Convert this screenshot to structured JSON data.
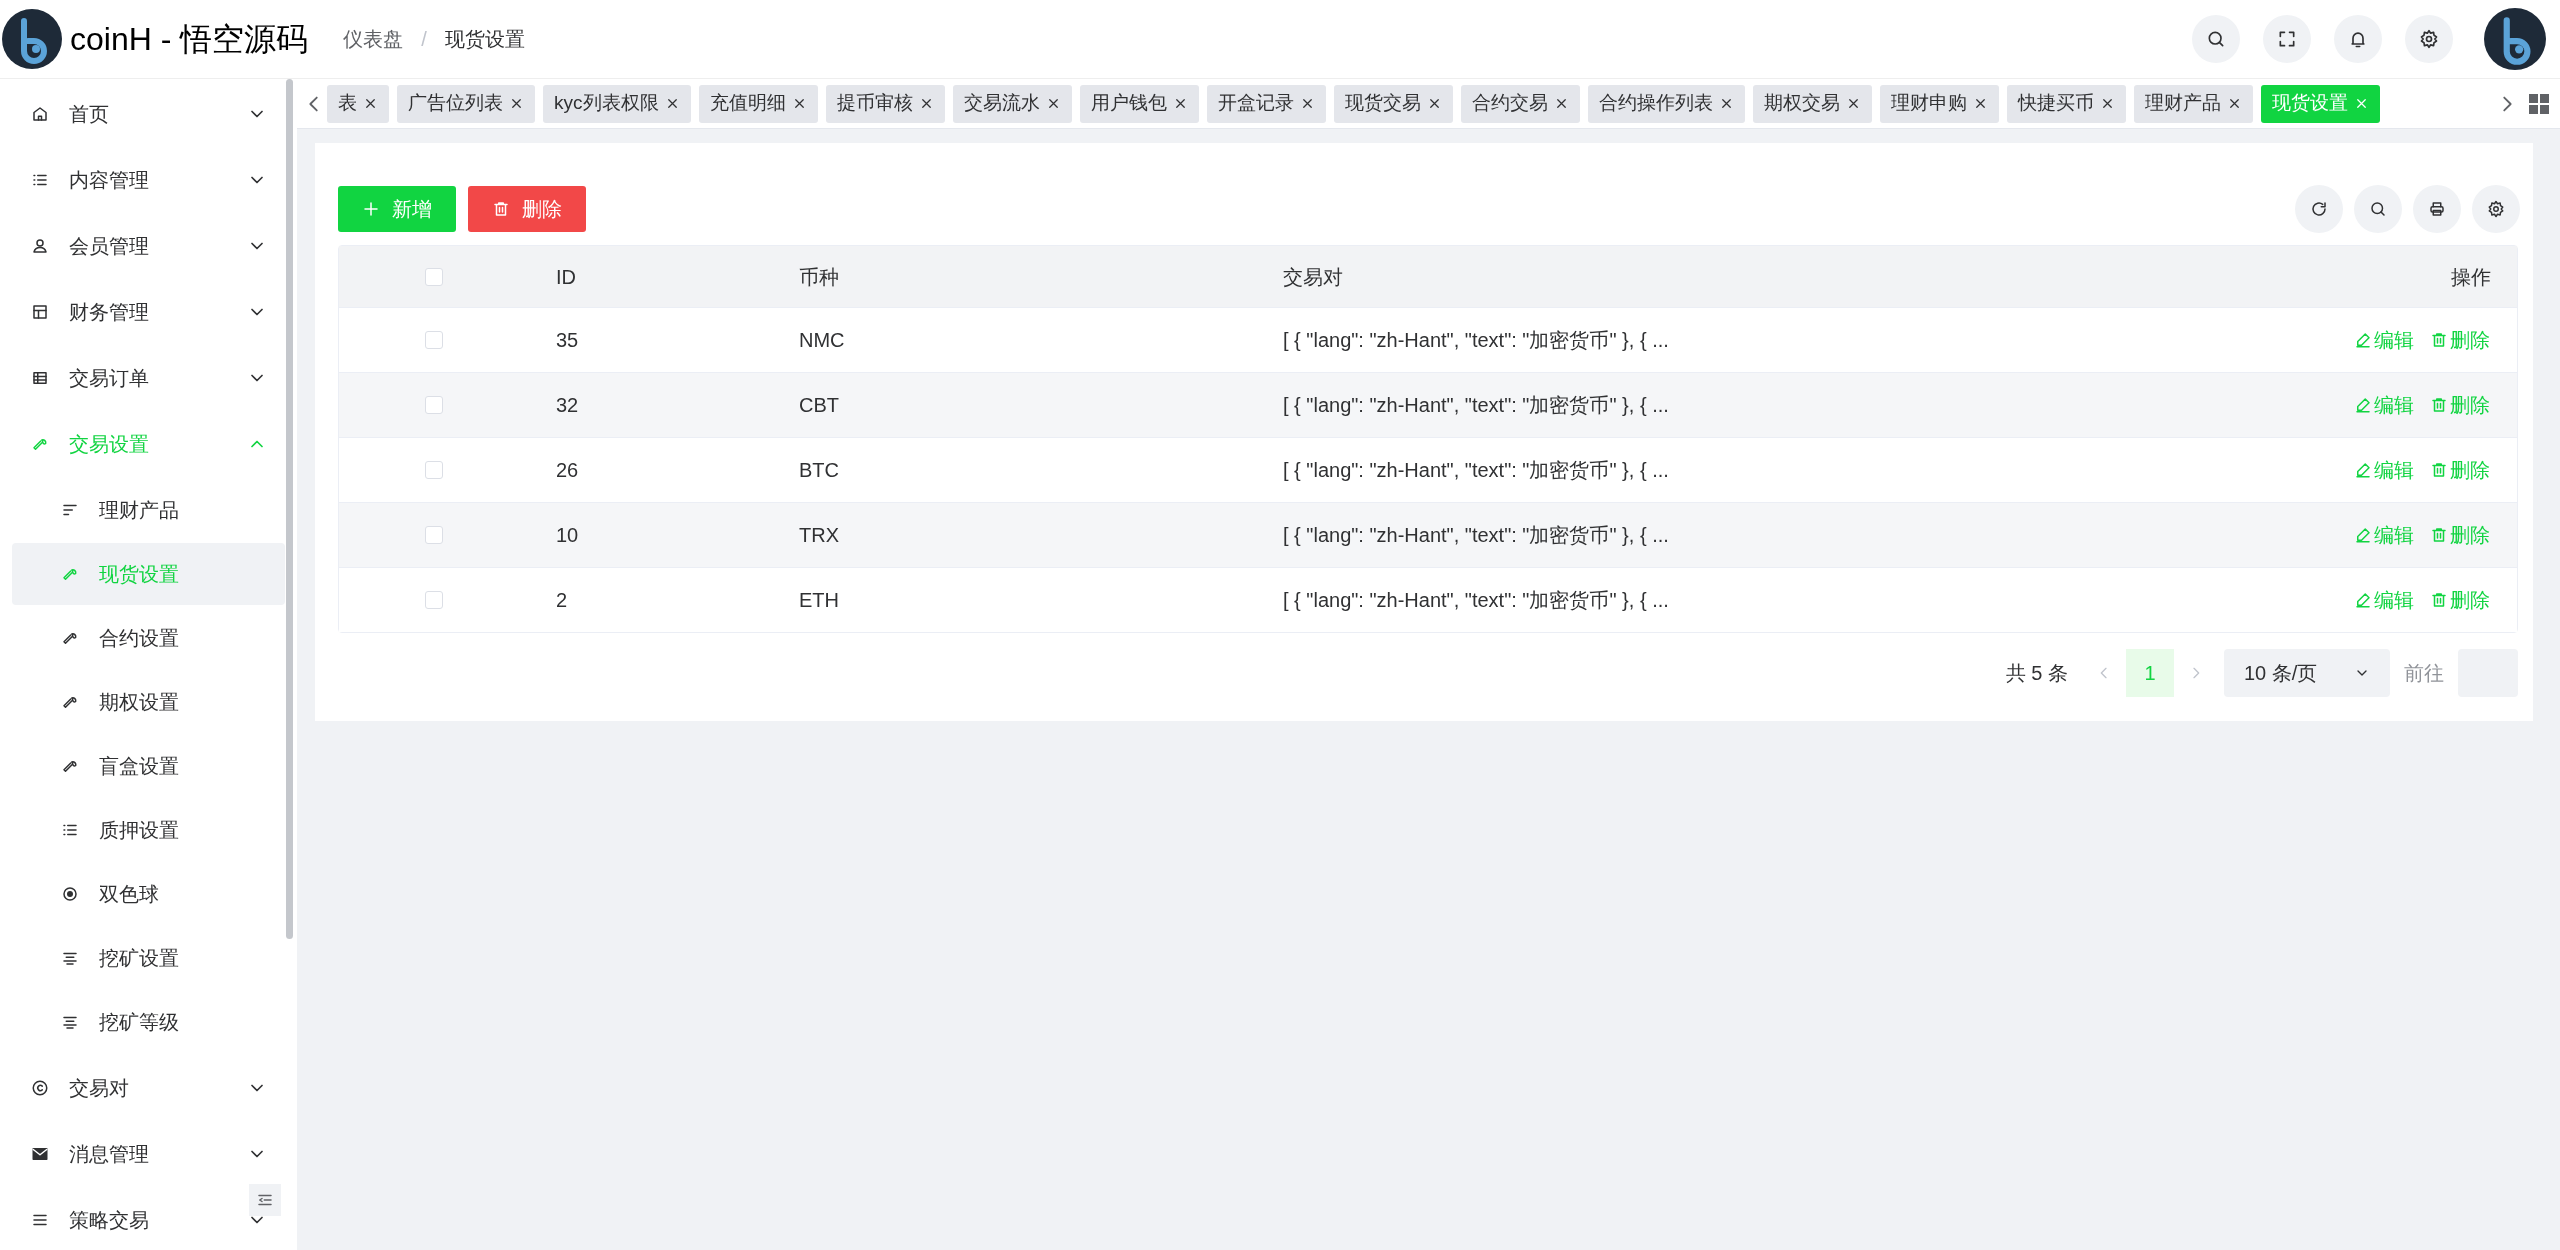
{
  "header": {
    "title": "coinH - 悟空源码",
    "breadcrumb": [
      "仪表盘",
      "现货设置"
    ],
    "separator": "/"
  },
  "sidebar": {
    "items": [
      {
        "label": "首页",
        "expanded": false,
        "active": false
      },
      {
        "label": "内容管理",
        "expanded": false,
        "active": false
      },
      {
        "label": "会员管理",
        "expanded": false,
        "active": false
      },
      {
        "label": "财务管理",
        "expanded": false,
        "active": false
      },
      {
        "label": "交易订单",
        "expanded": false,
        "active": false
      },
      {
        "label": "交易设置",
        "expanded": true,
        "active": true,
        "children": [
          {
            "label": "理财产品",
            "selected": false
          },
          {
            "label": "现货设置",
            "selected": true
          },
          {
            "label": "合约设置",
            "selected": false
          },
          {
            "label": "期权设置",
            "selected": false
          },
          {
            "label": "盲盒设置",
            "selected": false
          },
          {
            "label": "质押设置",
            "selected": false
          },
          {
            "label": "双色球",
            "selected": false
          },
          {
            "label": "挖矿设置",
            "selected": false
          },
          {
            "label": "挖矿等级",
            "selected": false
          }
        ]
      },
      {
        "label": "交易对",
        "expanded": false,
        "active": false
      },
      {
        "label": "消息管理",
        "expanded": false,
        "active": false
      },
      {
        "label": "策略交易",
        "expanded": false,
        "active": false
      }
    ]
  },
  "tabs": [
    {
      "label": "表",
      "selected": false
    },
    {
      "label": "广告位列表",
      "selected": false
    },
    {
      "label": "kyc列表权限",
      "selected": false
    },
    {
      "label": "充值明细",
      "selected": false
    },
    {
      "label": "提币审核",
      "selected": false
    },
    {
      "label": "交易流水",
      "selected": false
    },
    {
      "label": "用户钱包",
      "selected": false
    },
    {
      "label": "开盒记录",
      "selected": false
    },
    {
      "label": "现货交易",
      "selected": false
    },
    {
      "label": "合约交易",
      "selected": false
    },
    {
      "label": "合约操作列表",
      "selected": false
    },
    {
      "label": "期权交易",
      "selected": false
    },
    {
      "label": "理财申购",
      "selected": false
    },
    {
      "label": "快捷买币",
      "selected": false
    },
    {
      "label": "理财产品",
      "selected": false
    },
    {
      "label": "现货设置",
      "selected": true
    }
  ],
  "toolbar": {
    "add": "新增",
    "delete": "删除"
  },
  "table": {
    "columns": [
      "ID",
      "币种",
      "交易对",
      "操作"
    ],
    "select_all_checked": false,
    "rows": [
      {
        "checked": false,
        "cells": [
          "35",
          "NMC",
          "[ { \"lang\": \"zh-Hant\", \"text\": \"加密货币\" }, { ..."
        ],
        "actions": [
          "编辑",
          "删除"
        ]
      },
      {
        "checked": false,
        "cells": [
          "32",
          "CBT",
          "[ { \"lang\": \"zh-Hant\", \"text\": \"加密货币\" }, { ..."
        ],
        "actions": [
          "编辑",
          "删除"
        ]
      },
      {
        "checked": false,
        "cells": [
          "26",
          "BTC",
          "[ { \"lang\": \"zh-Hant\", \"text\": \"加密货币\" }, { ..."
        ],
        "actions": [
          "编辑",
          "删除"
        ]
      },
      {
        "checked": false,
        "cells": [
          "10",
          "TRX",
          "[ { \"lang\": \"zh-Hant\", \"text\": \"加密货币\" }, { ..."
        ],
        "actions": [
          "编辑",
          "删除"
        ]
      },
      {
        "checked": false,
        "cells": [
          "2",
          "ETH",
          "[ { \"lang\": \"zh-Hant\", \"text\": \"加密货币\" }, { ..."
        ],
        "actions": [
          "编辑",
          "删除"
        ]
      }
    ]
  },
  "pagination": {
    "total": "共 5 条",
    "pages": [
      {
        "label": "1",
        "selected": true
      }
    ],
    "page_size": "10 条/页",
    "goto": "前往"
  }
}
